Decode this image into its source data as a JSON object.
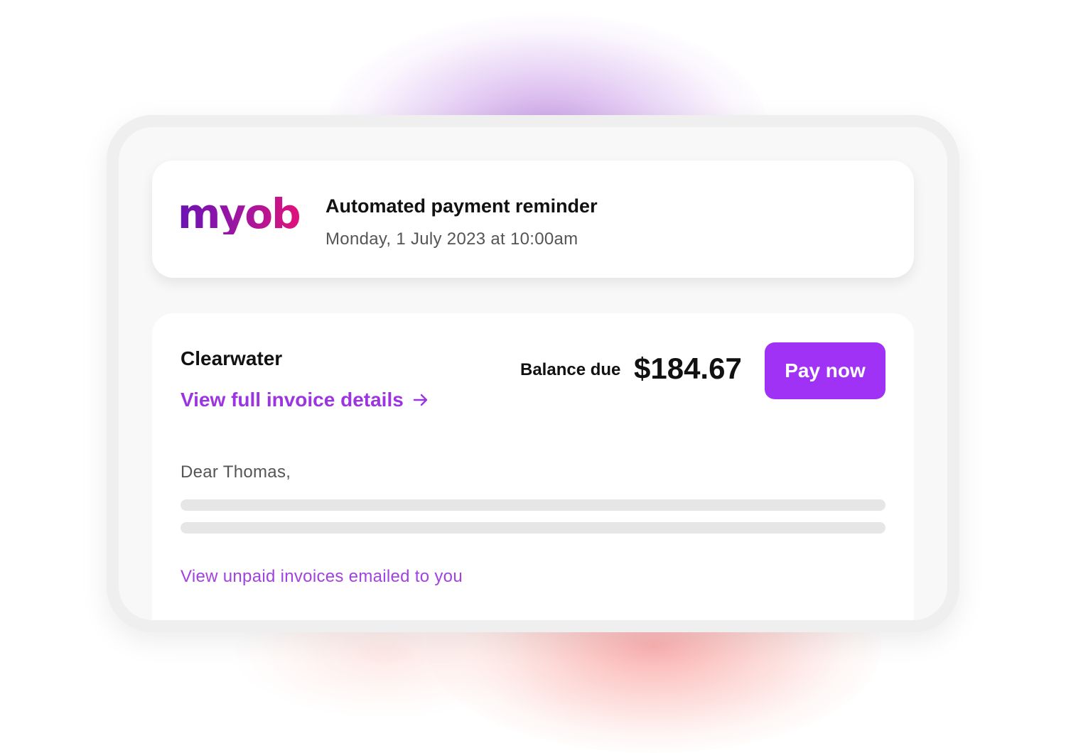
{
  "header": {
    "logo_text": "myob",
    "title": "Automated payment reminder",
    "datetime": "Monday, 1 July 2023 at 10:00am"
  },
  "invoice": {
    "company": "Clearwater",
    "view_details_label": "View full invoice details",
    "balance_label": "Balance due",
    "balance_amount": "$184.67",
    "pay_button_label": "Pay now"
  },
  "message": {
    "greeting": "Dear Thomas,",
    "unpaid_link_label": "View unpaid invoices emailed to you"
  },
  "colors": {
    "accent": "#a032f5",
    "link": "#9a35e0",
    "logo_gradient_start": "#6b12b5",
    "logo_gradient_end": "#e0127a"
  },
  "icons": {
    "details_arrow": "arrow-right-icon"
  }
}
